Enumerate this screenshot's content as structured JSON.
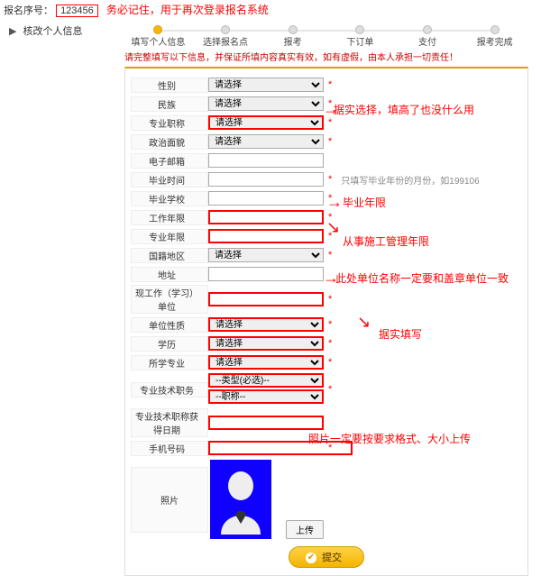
{
  "header": {
    "reg_label": "报名序号：",
    "reg_number": "123456",
    "top_note": "务必记住，用于再次登录报名系统"
  },
  "left_nav": {
    "item1": "核改个人信息"
  },
  "steps": [
    "填写个人信息",
    "选择报名点",
    "报考",
    "下订单",
    "支付",
    "报考完成"
  ],
  "hint": "请完整填写以下信息，并保证所填内容真实有效，如有虚假，由本人承担一切责任！",
  "labels": {
    "gender": "性别",
    "nation": "民族",
    "zyzc": "专业职称",
    "zzmm": "政治面貌",
    "email": "电子邮箱",
    "bysj": "毕业时间",
    "byxx": "毕业学校",
    "gznx": "工作年限",
    "zynx": "专业年限",
    "gjdq": "国籍地区",
    "addr": "地址",
    "xgzdw": "现工作（学习）单位",
    "dwxz": "单位性质",
    "xl": "学历",
    "sxzy": "所学专业",
    "zyjszw": "专业技术职务",
    "zyjsdate": "专业技术职称获得日期",
    "mobile": "手机号码",
    "photo": "照片"
  },
  "opts": {
    "select_default": "请选择",
    "type_required": "--类型(必选)--",
    "title_default": "--职称--"
  },
  "notes": {
    "bysj": "只填写毕业年份的月份，如199106"
  },
  "annotations": {
    "a1": "据实选择，填高了也没什么用",
    "a2": "毕业年限",
    "a3": "从事施工管理年限",
    "a4": "此处单位名称一定要和盖章单位一致",
    "a5": "据实填写",
    "a6": "照片一定要按要求格式、大小上传"
  },
  "buttons": {
    "upload": "上传",
    "submit": "提交"
  }
}
